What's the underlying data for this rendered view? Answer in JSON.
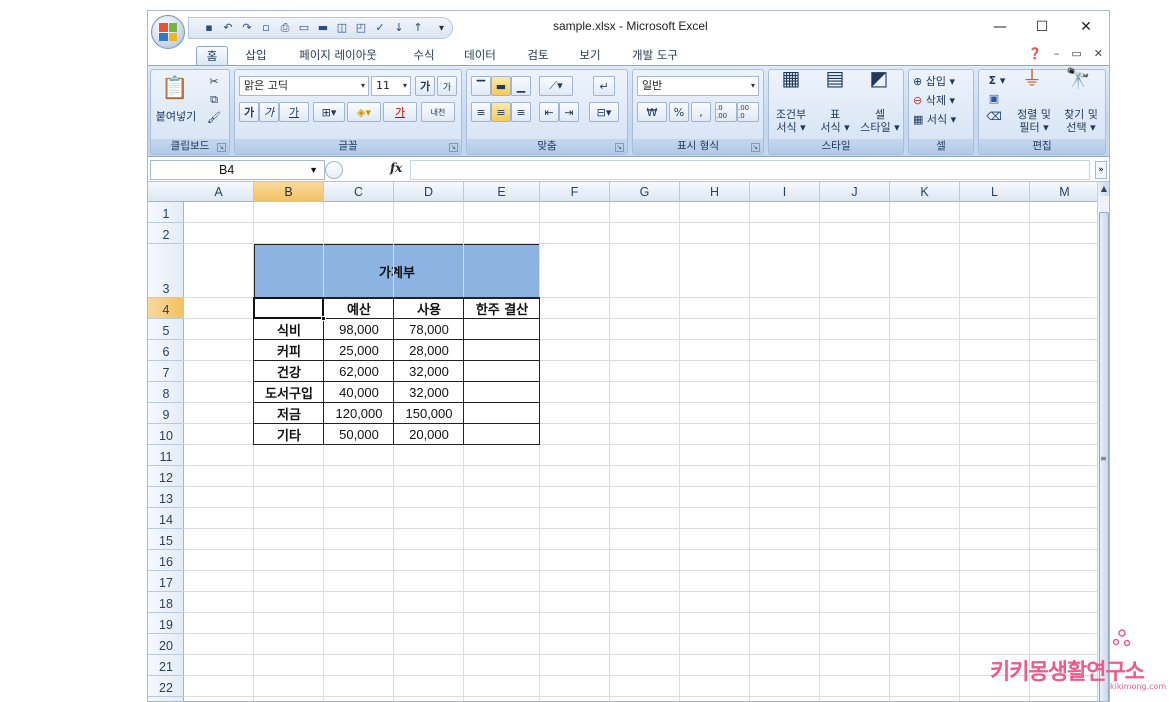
{
  "window": {
    "title": "sample.xlsx - Microsoft Excel",
    "controls": {
      "minimize": "—",
      "maximize": "☐",
      "close": "✕"
    }
  },
  "quick_access": {
    "icons": [
      "save-icon",
      "undo-icon",
      "redo-icon",
      "new-icon",
      "print-icon",
      "open-icon",
      "folder-icon",
      "print-preview-icon",
      "quick-print-icon",
      "spelling-icon",
      "sort-asc-icon",
      "sort-desc-icon"
    ],
    "more": "▾"
  },
  "ribbon_tabs": [
    {
      "label": "홈",
      "active": true
    },
    {
      "label": "삽입"
    },
    {
      "label": "페이지 레이아웃"
    },
    {
      "label": "수식"
    },
    {
      "label": "데이터"
    },
    {
      "label": "검토"
    },
    {
      "label": "보기"
    },
    {
      "label": "개발 도구"
    }
  ],
  "ribbon": {
    "clipboard": {
      "paste": "붙여넣기",
      "label": "클립보드"
    },
    "font": {
      "name": "맑은 고딕",
      "size": "11",
      "bold": "가",
      "italic": "가",
      "underline": "가",
      "grow": "가",
      "shrink": "가",
      "phonetic": "내천",
      "label": "글꼴"
    },
    "alignment": {
      "label": "맞춤"
    },
    "number": {
      "format": "일반",
      "currency": "₩",
      "percent": "%",
      "comma": ",",
      "inc_dec": ".0 .00",
      "dec_dec": ".00 .0",
      "label": "표시 형식"
    },
    "styles": {
      "conditional_1": "조건부",
      "conditional_2": "서식",
      "table_1": "표",
      "table_2": "서식",
      "cell_1": "셀",
      "cell_2": "스타일",
      "label": "스타일"
    },
    "cells": {
      "insert": "삽입",
      "delete": "삭제",
      "format": "서식",
      "label": "셀"
    },
    "editing": {
      "sigma": "Σ",
      "sort_1": "정렬 및",
      "sort_2": "필터",
      "find_1": "찾기 및",
      "find_2": "선택",
      "label": "편집"
    }
  },
  "formula_bar": {
    "name_box": "B4",
    "fx": "fx",
    "formula": ""
  },
  "columns": [
    "A",
    "B",
    "C",
    "D",
    "E",
    "F",
    "G",
    "H",
    "I",
    "J",
    "K",
    "L",
    "M"
  ],
  "selected_column": "B",
  "rows": [
    "1",
    "2",
    "3",
    "4",
    "5",
    "6",
    "7",
    "8",
    "9",
    "10",
    "11",
    "12",
    "13",
    "14",
    "15",
    "16",
    "17",
    "18",
    "19",
    "20",
    "21",
    "22"
  ],
  "selected_row": "4",
  "sheet": {
    "title": "가계부",
    "headers": [
      "",
      "예산",
      "사용",
      "한주 결산"
    ],
    "data": [
      {
        "item": "식비",
        "budget": "98,000",
        "used": "78,000",
        "result": ""
      },
      {
        "item": "커피",
        "budget": "25,000",
        "used": "28,000",
        "result": ""
      },
      {
        "item": "건강",
        "budget": "62,000",
        "used": "32,000",
        "result": ""
      },
      {
        "item": "도서구입",
        "budget": "40,000",
        "used": "32,000",
        "result": ""
      },
      {
        "item": "저금",
        "budget": "120,000",
        "used": "150,000",
        "result": ""
      },
      {
        "item": "기타",
        "budget": "50,000",
        "used": "20,000",
        "result": ""
      }
    ]
  },
  "watermark": {
    "text": "키키몽생활연구소",
    "url": "kikimong.com"
  },
  "colors": {
    "title_fill": "#8db3e2",
    "accent": "#f05a8a",
    "selection": "#f1c15f"
  }
}
